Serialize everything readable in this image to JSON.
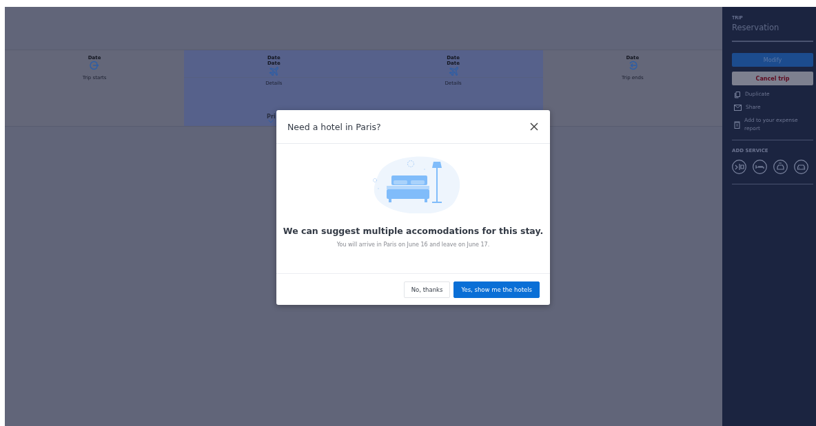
{
  "timeline": [
    {
      "kind": "start",
      "dates": [
        "Date"
      ],
      "label": "Trip starts",
      "highlighted": false
    },
    {
      "kind": "flight",
      "dates": [
        "Date",
        "Date"
      ],
      "label": "Details",
      "highlighted": true,
      "extra": "Pri"
    },
    {
      "kind": "flight",
      "dates": [
        "Date",
        "Date"
      ],
      "label": "Details",
      "highlighted": true
    },
    {
      "kind": "end",
      "dates": [
        "Date"
      ],
      "label": "Trip ends",
      "highlighted": false
    }
  ],
  "sidebar": {
    "section_label": "TRIP",
    "title": "Reservation",
    "buttons": [
      {
        "label": "Modify",
        "kind": "primary"
      },
      {
        "label": "Cancel trip",
        "kind": "danger"
      }
    ],
    "actions": [
      {
        "label": "Duplicate",
        "kind": "duplicate"
      },
      {
        "label": "Share",
        "kind": "share"
      },
      {
        "label": "Add to your expense report",
        "kind": "expense"
      }
    ],
    "add_service_title": "ADD SERVICE"
  },
  "modal": {
    "title": "Need a hotel in Paris?",
    "headline": "We can suggest multiple accomodations for this stay.",
    "text": "You will arrive in Paris on June 16 and leave on June 17.",
    "buttons": [
      {
        "label": "No, thanks",
        "kind": "secondary"
      },
      {
        "label": "Yes, show me the hotels",
        "kind": "primary"
      }
    ]
  }
}
